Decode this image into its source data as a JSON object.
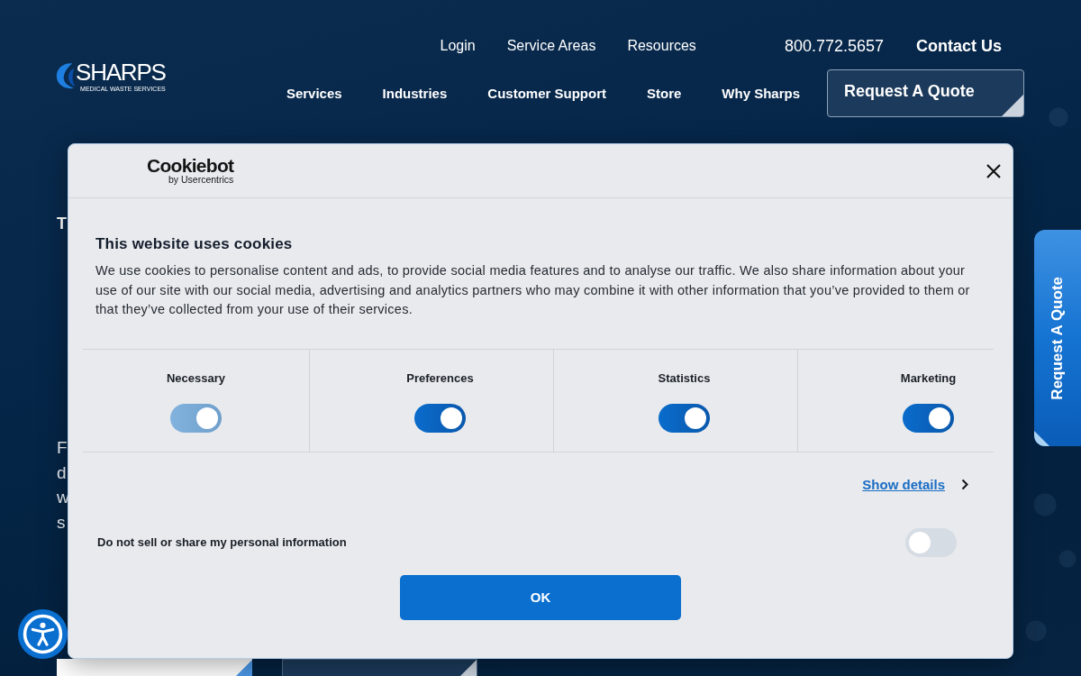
{
  "header": {
    "logo": {
      "name": "SHARPS",
      "tagline": "MEDICAL WASTE SERVICES"
    },
    "utility_links": [
      {
        "label": "Login"
      },
      {
        "label": "Service Areas"
      },
      {
        "label": "Resources"
      }
    ],
    "phone": "800.772.5657",
    "contact": "Contact Us",
    "main_nav": [
      {
        "label": "Services"
      },
      {
        "label": "Industries"
      },
      {
        "label": "Customer Support"
      },
      {
        "label": "Store"
      },
      {
        "label": "Why Sharps"
      }
    ],
    "quote_button": "Request A Quote"
  },
  "hero": {
    "eyebrow": "T",
    "body_lines": [
      "F",
      "d",
      "w",
      "s"
    ]
  },
  "side_tab": {
    "label": "Request A Quote"
  },
  "cookie_dialog": {
    "brand": "Cookiebot",
    "brand_sub": "by Usercentrics",
    "title": "This website uses cookies",
    "body": "We use cookies to personalise content and ads, to provide social media features and to analyse our traffic. We also share information about your use of our site with our social media, advertising and analytics partners who may combine it with other information that you’ve provided to them or that they’ve collected from your use of their services.",
    "categories": [
      {
        "label": "Necessary",
        "on": true,
        "disabled": true
      },
      {
        "label": "Preferences",
        "on": true,
        "disabled": false
      },
      {
        "label": "Statistics",
        "on": true,
        "disabled": false
      },
      {
        "label": "Marketing",
        "on": true,
        "disabled": false
      }
    ],
    "details_link": "Show details",
    "do_not_sell": {
      "label": "Do not sell or share my personal information",
      "on": false
    },
    "ok_button": "OK"
  }
}
